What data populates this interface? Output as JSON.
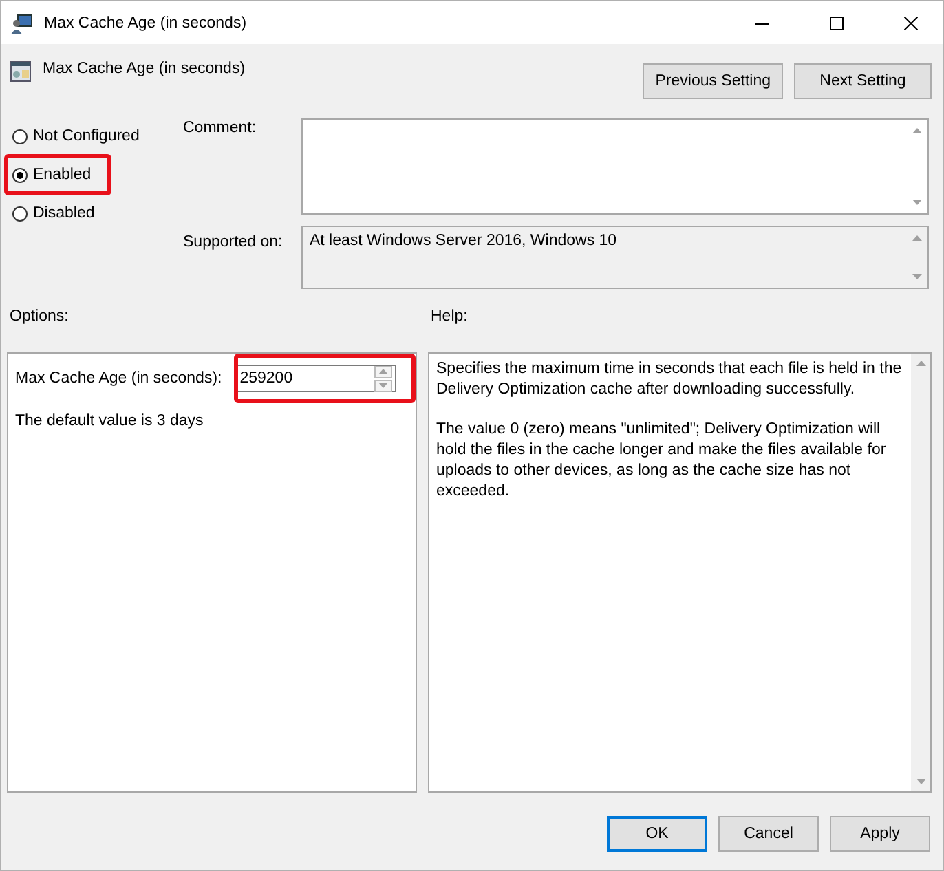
{
  "window": {
    "title": "Max Cache Age (in seconds)"
  },
  "header": {
    "title": "Max Cache Age (in seconds)",
    "buttons": [
      "Previous Setting",
      "Next Setting"
    ]
  },
  "state_options": [
    {
      "label": "Not Configured",
      "selected": false,
      "highlighted": false
    },
    {
      "label": "Enabled",
      "selected": true,
      "highlighted": true
    },
    {
      "label": "Disabled",
      "selected": false,
      "highlighted": false
    }
  ],
  "comment": {
    "label": "Comment:"
  },
  "supported_on": {
    "label": "Supported on:",
    "value": "At least Windows Server 2016, Windows 10"
  },
  "options": {
    "label": "Options:",
    "field_label": "Max Cache Age (in seconds):",
    "value": "259200",
    "highlighted": true,
    "note": "The default value is 3 days"
  },
  "help": {
    "label": "Help:",
    "paragraphs": [
      "Specifies the maximum time in seconds that each file is held in the Delivery Optimization cache after downloading successfully.",
      "The value 0 (zero) means \"unlimited\"; Delivery Optimization will hold the files in the cache longer and make the files available for uploads to other devices, as long as the cache size has not exceeded."
    ]
  },
  "buttons": [
    {
      "label": "OK",
      "selected": true
    },
    {
      "label": "Cancel",
      "selected": false
    },
    {
      "label": "Apply",
      "selected": false
    }
  ]
}
